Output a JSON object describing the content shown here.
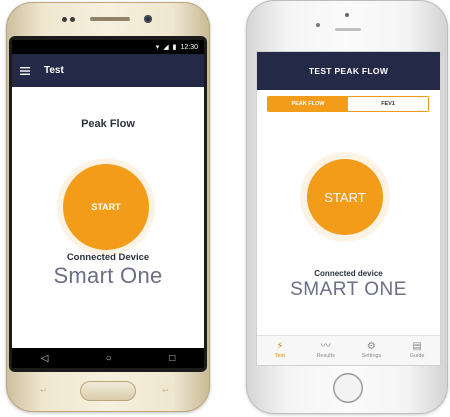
{
  "android": {
    "status_time": "12:30",
    "appbar_title": "Test",
    "menu_icon": "hamburger-menu-icon",
    "heading": "Peak Flow",
    "start_label": "START",
    "connected_label": "Connected Device",
    "device_name": "Smart One",
    "nav": {
      "back": "◁",
      "home": "○",
      "recents": "□"
    }
  },
  "ios": {
    "header_title": "TEST PEAK FLOW",
    "segments": [
      "PEAK FLOW",
      "FEV1"
    ],
    "start_label": "START",
    "connected_label": "Connected device",
    "device_name": "SMART ONE",
    "tabs": [
      {
        "label": "Test",
        "icon": "test-icon"
      },
      {
        "label": "Results",
        "icon": "results-chart-icon"
      },
      {
        "label": "Settings",
        "icon": "settings-gear-icon"
      },
      {
        "label": "Guide",
        "icon": "guide-book-icon"
      }
    ]
  },
  "colors": {
    "accent": "#f39c1a",
    "header": "#232946",
    "device_text": "#6b6e84"
  }
}
